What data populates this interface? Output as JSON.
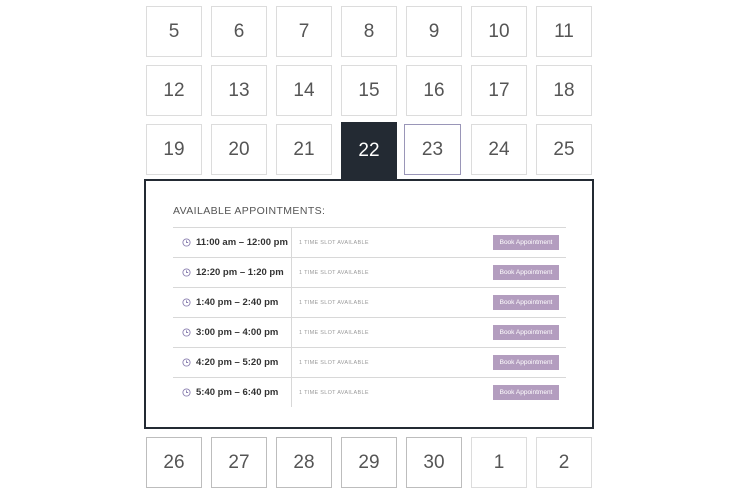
{
  "calendar": {
    "rows": [
      [
        "5",
        "6",
        "7",
        "8",
        "9",
        "10",
        "11"
      ],
      [
        "12",
        "13",
        "14",
        "15",
        "16",
        "17",
        "18"
      ],
      [
        "19",
        "20",
        "21",
        "22",
        "23",
        "24",
        "25"
      ],
      [
        "26",
        "27",
        "28",
        "29",
        "30",
        "1",
        "2"
      ]
    ],
    "selected_day": "22",
    "hovered_day": "23"
  },
  "panel": {
    "title": "AVAILABLE APPOINTMENTS:",
    "slots": [
      {
        "time": "11:00 am – 12:00 pm",
        "availability": "1 TIME SLOT AVAILABLE",
        "button": "Book Appointment"
      },
      {
        "time": "12:20 pm – 1:20 pm",
        "availability": "1 TIME SLOT AVAILABLE",
        "button": "Book Appointment"
      },
      {
        "time": "1:40 pm – 2:40 pm",
        "availability": "1 TIME SLOT AVAILABLE",
        "button": "Book Appointment"
      },
      {
        "time": "3:00 pm – 4:00 pm",
        "availability": "1 TIME SLOT AVAILABLE",
        "button": "Book Appointment"
      },
      {
        "time": "4:20 pm – 5:20 pm",
        "availability": "1 TIME SLOT AVAILABLE",
        "button": "Book Appointment"
      },
      {
        "time": "5:40 pm – 6:40 pm",
        "availability": "1 TIME SLOT AVAILABLE",
        "button": "Book Appointment"
      }
    ]
  },
  "colors": {
    "selected_bg": "#232a33",
    "book_button": "#b39dbf",
    "clock_icon": "#8a7fb0"
  },
  "icons": {
    "slot_icon": "clock-icon"
  }
}
